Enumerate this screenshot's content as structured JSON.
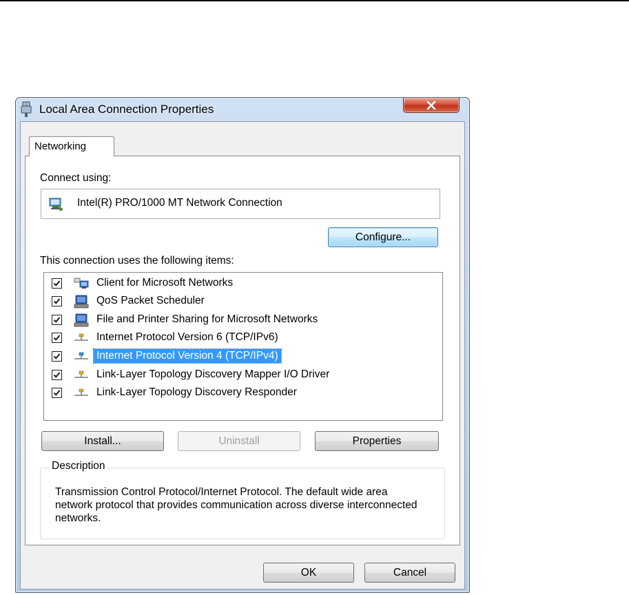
{
  "window": {
    "title": "Local Area Connection Properties"
  },
  "tabs": [
    {
      "label": "Networking",
      "active": true
    }
  ],
  "connect_using": {
    "label": "Connect using:",
    "adapter_name": "Intel(R) PRO/1000 MT Network Connection",
    "configure_label": "Configure..."
  },
  "items": {
    "label": "This connection uses the following items:",
    "list": [
      {
        "label": "Client for Microsoft Networks",
        "checked": true,
        "icon": "network-client-icon"
      },
      {
        "label": "QoS Packet Scheduler",
        "checked": true,
        "icon": "network-service-icon"
      },
      {
        "label": "File and Printer Sharing for Microsoft Networks",
        "checked": true,
        "icon": "network-service-icon"
      },
      {
        "label": "Internet Protocol Version 6 (TCP/IPv6)",
        "checked": true,
        "icon": "network-protocol-icon"
      },
      {
        "label": "Internet Protocol Version 4 (TCP/IPv4)",
        "checked": true,
        "icon": "network-protocol-icon",
        "selected": true
      },
      {
        "label": "Link-Layer Topology Discovery Mapper I/O Driver",
        "checked": true,
        "icon": "network-protocol-icon"
      },
      {
        "label": "Link-Layer Topology Discovery Responder",
        "checked": true,
        "icon": "network-protocol-icon"
      }
    ]
  },
  "actions": {
    "install_label": "Install...",
    "uninstall_label": "Uninstall",
    "properties_label": "Properties"
  },
  "description": {
    "legend": "Description",
    "text": "Transmission Control Protocol/Internet Protocol. The default wide area network protocol that provides communication across diverse interconnected networks."
  },
  "footer": {
    "ok_label": "OK",
    "cancel_label": "Cancel"
  },
  "colors": {
    "selection": "#3399ff",
    "close_button": "#c7462f",
    "titlebar": "#bcd3ec"
  }
}
